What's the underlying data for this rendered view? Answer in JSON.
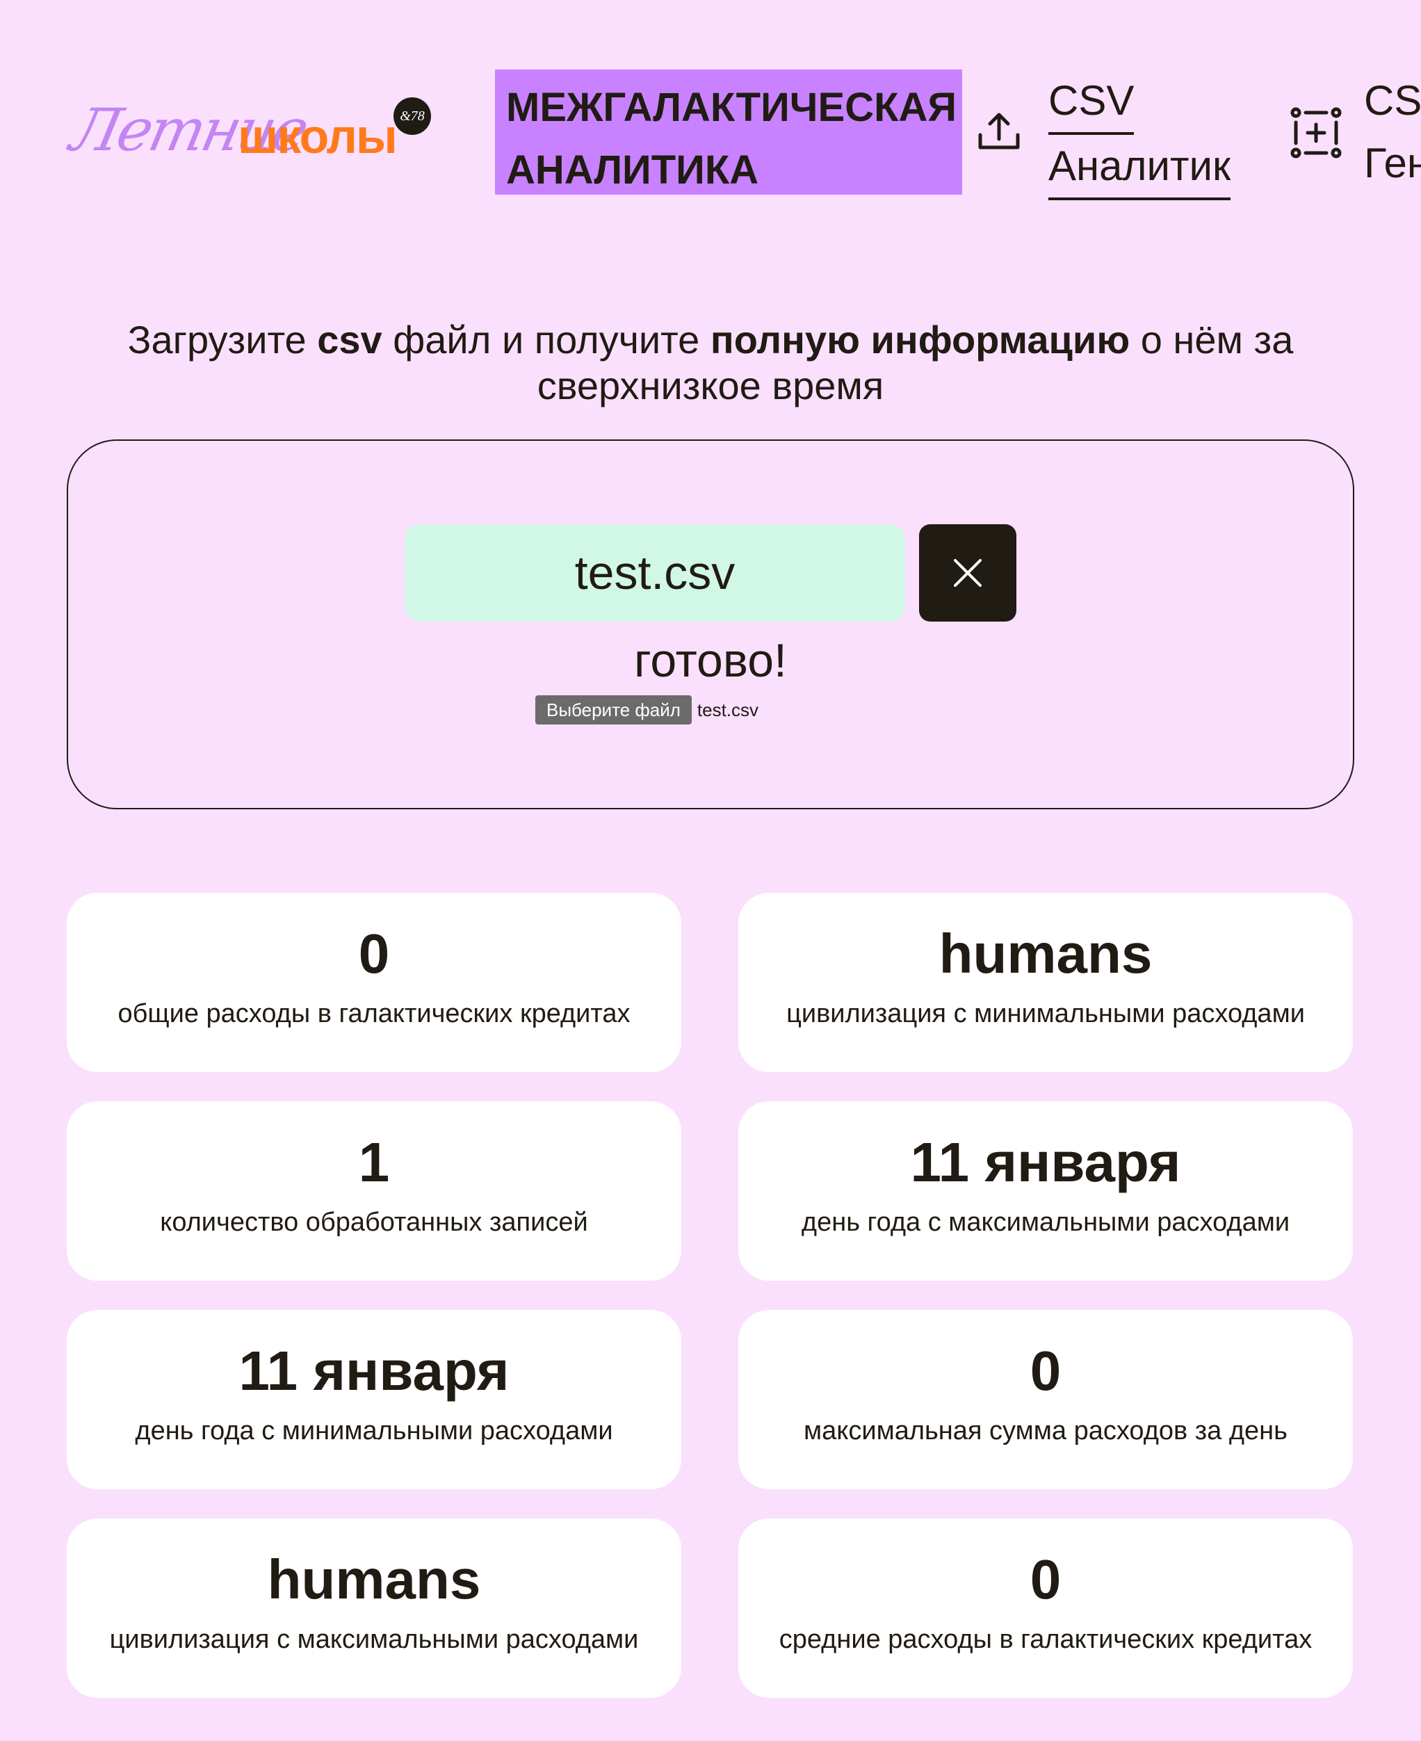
{
  "header": {
    "logo": {
      "script_text": "Летние",
      "bold_text": "школы",
      "badge": "&78"
    },
    "brand_title_line1": "МЕЖГАЛАКТИЧЕСКАЯ",
    "brand_title_line2": "АНАЛИТИКА",
    "nav": [
      {
        "icon": "upload-icon",
        "line1": "CSV",
        "line2": "Аналитик"
      },
      {
        "icon": "generator-icon",
        "line1": "CSV",
        "line2": "Ген"
      }
    ]
  },
  "lead": {
    "part1": "Загрузите ",
    "bold1": "csv",
    "part2": " файл и получите ",
    "bold2": "полную информацию",
    "part3": " о нём за",
    "line2": "сверхнизкое время"
  },
  "upload": {
    "filename": "test.csv",
    "clear_icon": "close-icon",
    "status": "готово!",
    "file_button_label": "Выберите файл",
    "file_chosen": "test.csv"
  },
  "stats": [
    {
      "value": "0",
      "label": "общие расходы в галактических кредитах"
    },
    {
      "value": "humans",
      "label": "цивилизация с минимальными расходами"
    },
    {
      "value": "1",
      "label": "количество обработанных записей"
    },
    {
      "value": "11 января",
      "label": "день года с максимальными расходами"
    },
    {
      "value": "11 января",
      "label": "день года с минимальными расходами"
    },
    {
      "value": "0",
      "label": "максимальная сумма расходов за день"
    },
    {
      "value": "humans",
      "label": "цивилизация с максимальными расходами"
    },
    {
      "value": "0",
      "label": "средние расходы в галактических кредитах"
    }
  ],
  "colors": {
    "background": "#fae0fd",
    "brand_purple": "#c882ff",
    "logo_orange": "#ff7a1b",
    "filename_green": "#d1f7e6",
    "dark": "#201b13"
  }
}
